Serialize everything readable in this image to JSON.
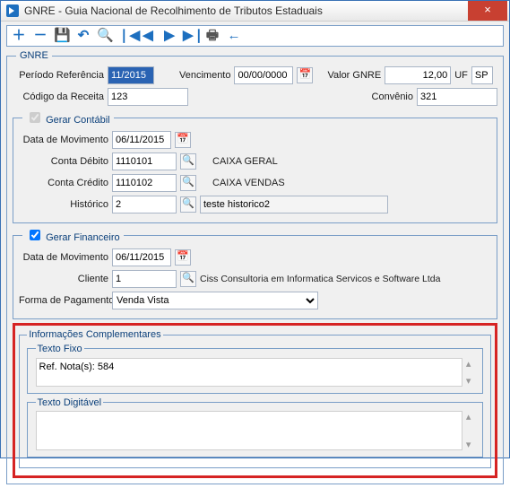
{
  "window": {
    "title": "GNRE - Guia Nacional de Recolhimento de Tributos Estaduais"
  },
  "toolbar": {
    "add": "+",
    "remove": "−",
    "save": "💾",
    "undo": "↶",
    "search": "🔍",
    "first": "|◀",
    "prev": "◀",
    "next": "▶",
    "last": "▶|",
    "print": "🖨",
    "back": "←"
  },
  "gnre": {
    "legend": "GNRE",
    "periodo_lbl": "Período Referência",
    "periodo_val": "11/2015",
    "venc_lbl": "Vencimento",
    "venc_val": "00/00/0000",
    "valor_lbl": "Valor GNRE",
    "valor_val": "12,00",
    "uf_lbl": "UF",
    "uf_val": "SP",
    "codrec_lbl": "Código da Receita",
    "codrec_val": "123",
    "convenio_lbl": "Convênio",
    "convenio_val": "321",
    "contabil": {
      "legend_cb": "Gerar Contábil",
      "data_lbl": "Data de Movimento",
      "data_val": "06/11/2015",
      "deb_lbl": "Conta Débito",
      "deb_val": "1110101",
      "deb_desc": "CAIXA GERAL",
      "cred_lbl": "Conta Crédito",
      "cred_val": "1110102",
      "cred_desc": "CAIXA VENDAS",
      "hist_lbl": "Histórico",
      "hist_val": "2",
      "hist_desc": "teste historico2"
    },
    "financeiro": {
      "legend_cb": "Gerar Financeiro",
      "data_lbl": "Data de Movimento",
      "data_val": "06/11/2015",
      "cliente_lbl": "Cliente",
      "cliente_val": "1",
      "cliente_desc": "Ciss Consultoria em Informatica Servicos e Software Ltda",
      "forma_lbl": "Forma de Pagamento",
      "forma_val": "Venda Vista"
    },
    "compl": {
      "legend": "Informações Complementares",
      "fixo_legend": "Texto Fixo",
      "fixo_val": "Ref. Nota(s): 584",
      "digit_legend": "Texto Digitável",
      "digit_val": ""
    }
  }
}
